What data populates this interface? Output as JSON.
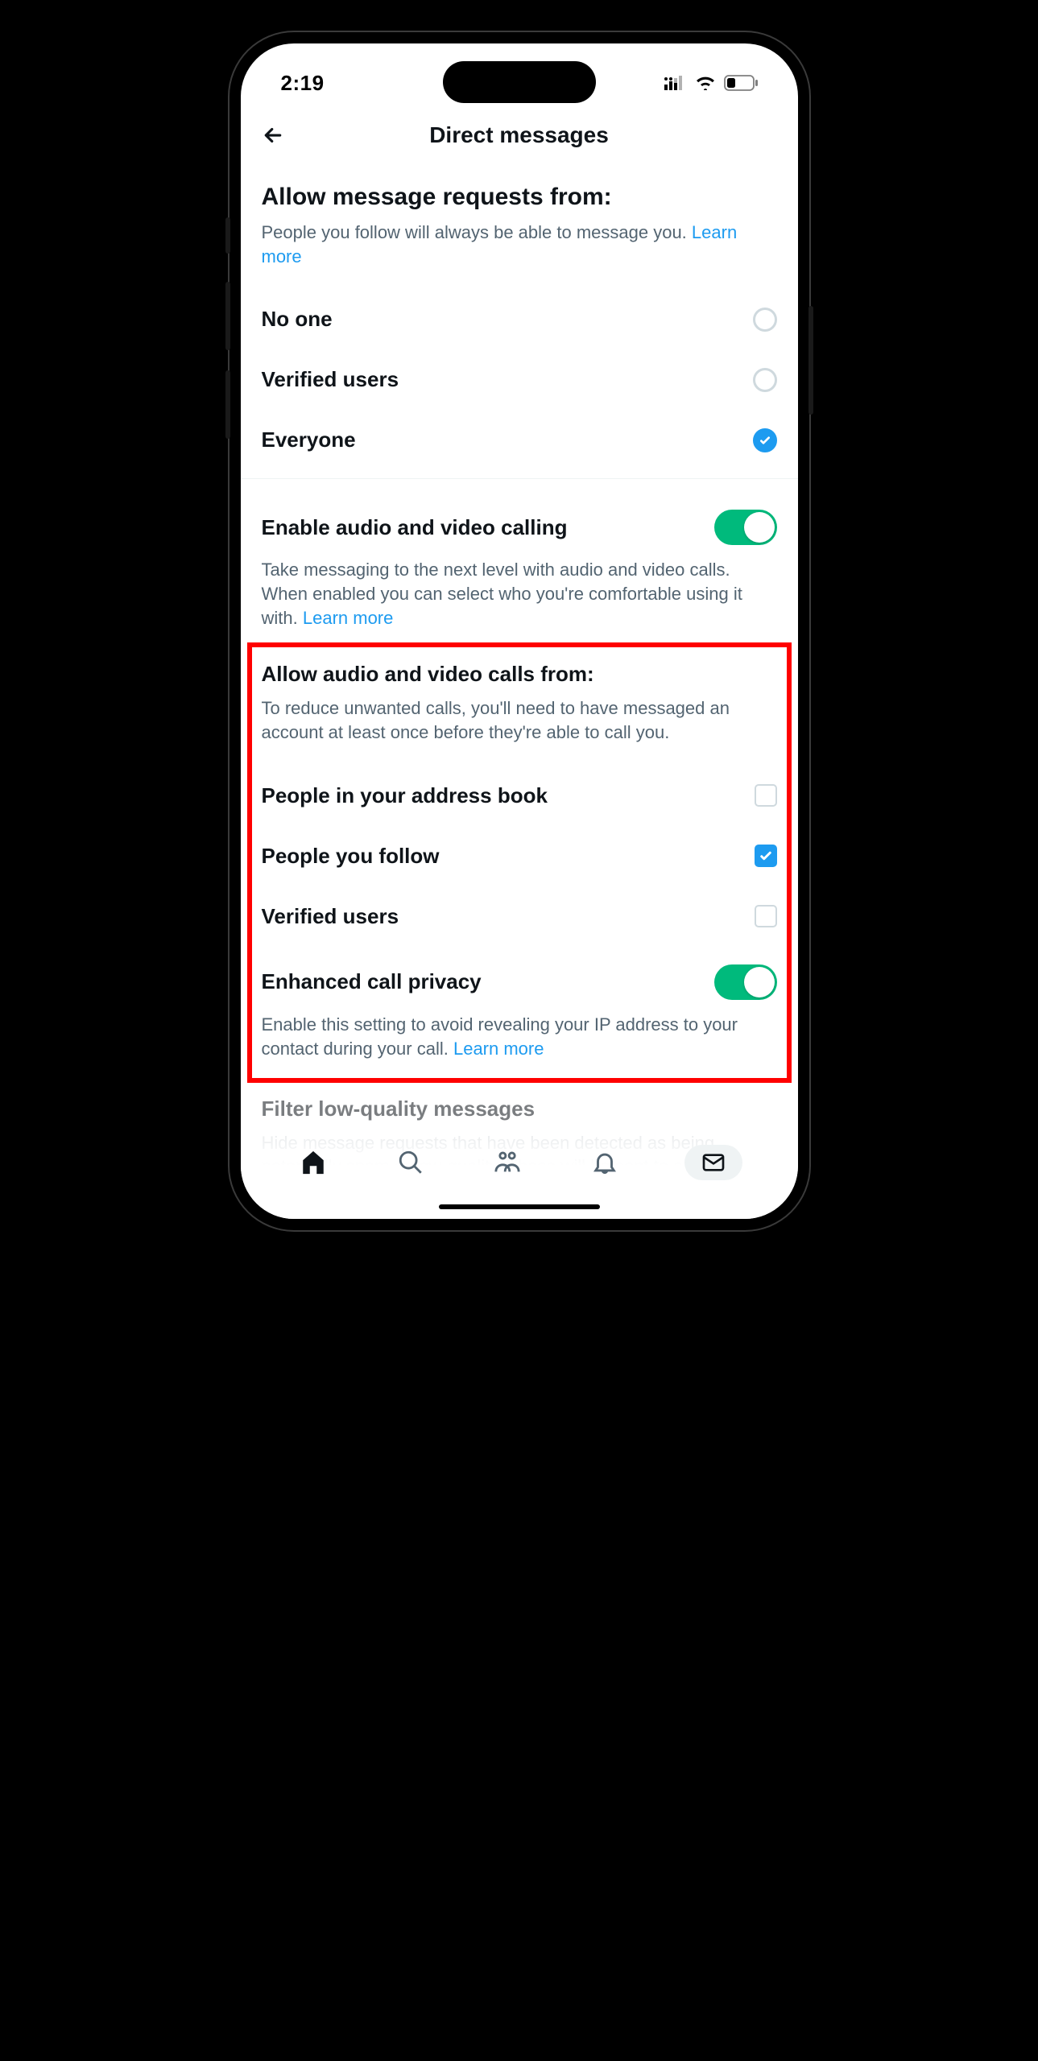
{
  "status": {
    "time": "2:19"
  },
  "header": {
    "title": "Direct messages"
  },
  "section1": {
    "title": "Allow message requests from:",
    "subtitle": "People you follow will always be able to message you. ",
    "learn": "Learn more",
    "options": [
      {
        "label": "No one",
        "selected": false
      },
      {
        "label": "Verified users",
        "selected": false
      },
      {
        "label": "Everyone",
        "selected": true
      }
    ]
  },
  "section2": {
    "title": "Enable audio and video calling",
    "desc": "Take messaging to the next level with audio and video calls. When enabled you can select who you're comfortable using it with. ",
    "learn": "Learn more",
    "enabled": true
  },
  "section3": {
    "title": "Allow audio and video calls from:",
    "subtitle": "To reduce unwanted calls, you'll need to have messaged an account at least once before they're able to call you.",
    "checks": [
      {
        "label": "People in your address book",
        "checked": false
      },
      {
        "label": "People you follow",
        "checked": true
      },
      {
        "label": "Verified users",
        "checked": false
      }
    ],
    "privacy": {
      "title": "Enhanced call privacy",
      "desc": "Enable this setting to avoid revealing your IP address to your contact during your call. ",
      "learn": "Learn more",
      "enabled": true
    }
  },
  "section4": {
    "title": "Filter low-quality messages",
    "desc": "Hide message requests that have been detected as being potentially spam or low-quality. These will be sent to a"
  }
}
